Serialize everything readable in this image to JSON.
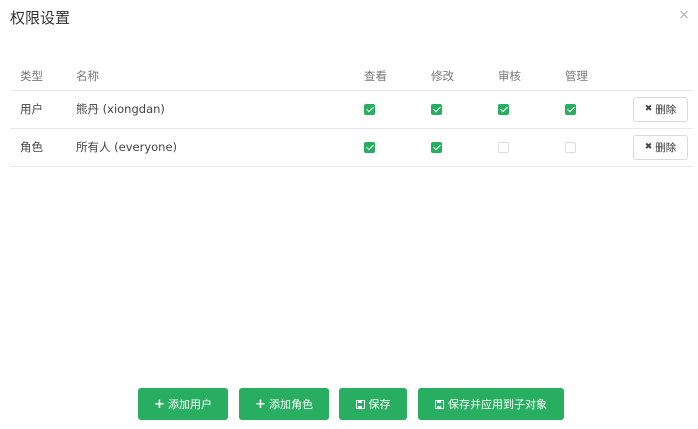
{
  "dialog": {
    "title": "权限设置",
    "close_icon": "×"
  },
  "table": {
    "headers": {
      "type": "类型",
      "name": "名称",
      "view": "查看",
      "edit": "修改",
      "audit": "审核",
      "manage": "管理"
    },
    "rows": [
      {
        "type": "用户",
        "name": "熊丹 (xiongdan)",
        "view": true,
        "edit": true,
        "audit": true,
        "manage": true,
        "delete_label": "删除"
      },
      {
        "type": "角色",
        "name": "所有人 (everyone)",
        "view": true,
        "edit": true,
        "audit": false,
        "manage": false,
        "delete_label": "删除"
      }
    ],
    "delete_icon": "✖",
    "check_color": "#27ae60"
  },
  "footer": {
    "add_user": "添加用户",
    "add_role": "添加角色",
    "save": "保存",
    "save_apply": "保存并应用到子对象",
    "plus_icon": "+",
    "button_color": "#27ae60"
  }
}
